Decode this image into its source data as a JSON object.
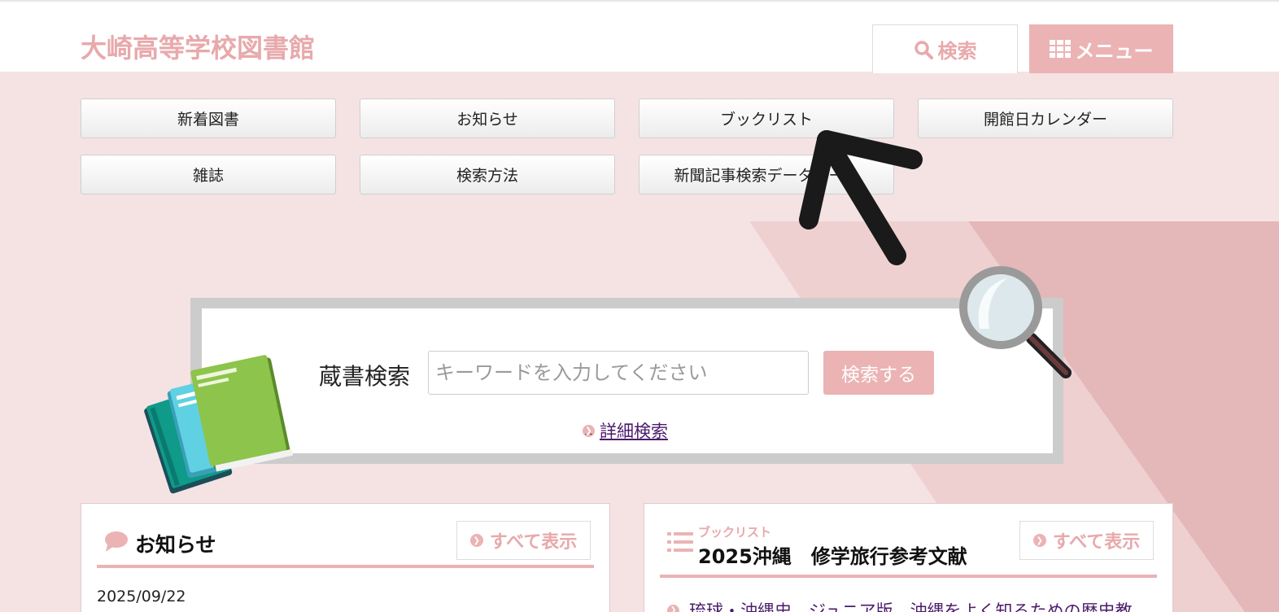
{
  "header": {
    "site_title": "大崎高等学校図書館",
    "search_label": "検索",
    "menu_label": "メニュー"
  },
  "nav": {
    "items": [
      {
        "label": "新着図書"
      },
      {
        "label": "お知らせ"
      },
      {
        "label": "ブックリスト"
      },
      {
        "label": "開館日カレンダー"
      },
      {
        "label": "雑誌"
      },
      {
        "label": "検索方法"
      },
      {
        "label": "新聞記事検索データベース"
      }
    ]
  },
  "search": {
    "label": "蔵書検索",
    "placeholder": "キーワードを入力してください",
    "submit_label": "検索する",
    "advanced_label": "詳細検索"
  },
  "news": {
    "title": "お知らせ",
    "more_label": "すべて表示",
    "first_date": "2025/09/22"
  },
  "booklist": {
    "kicker": "ブックリスト",
    "title": "2025沖縄　修学旅行参考文献",
    "more_label": "すべて表示",
    "first_item": "琉球・沖縄史　ジュニア版　沖縄をよく知るための歴史教"
  },
  "colors": {
    "accent": "#ebb3b4",
    "page_bg": "#f5e3e4",
    "link": "#4b1b6b"
  }
}
